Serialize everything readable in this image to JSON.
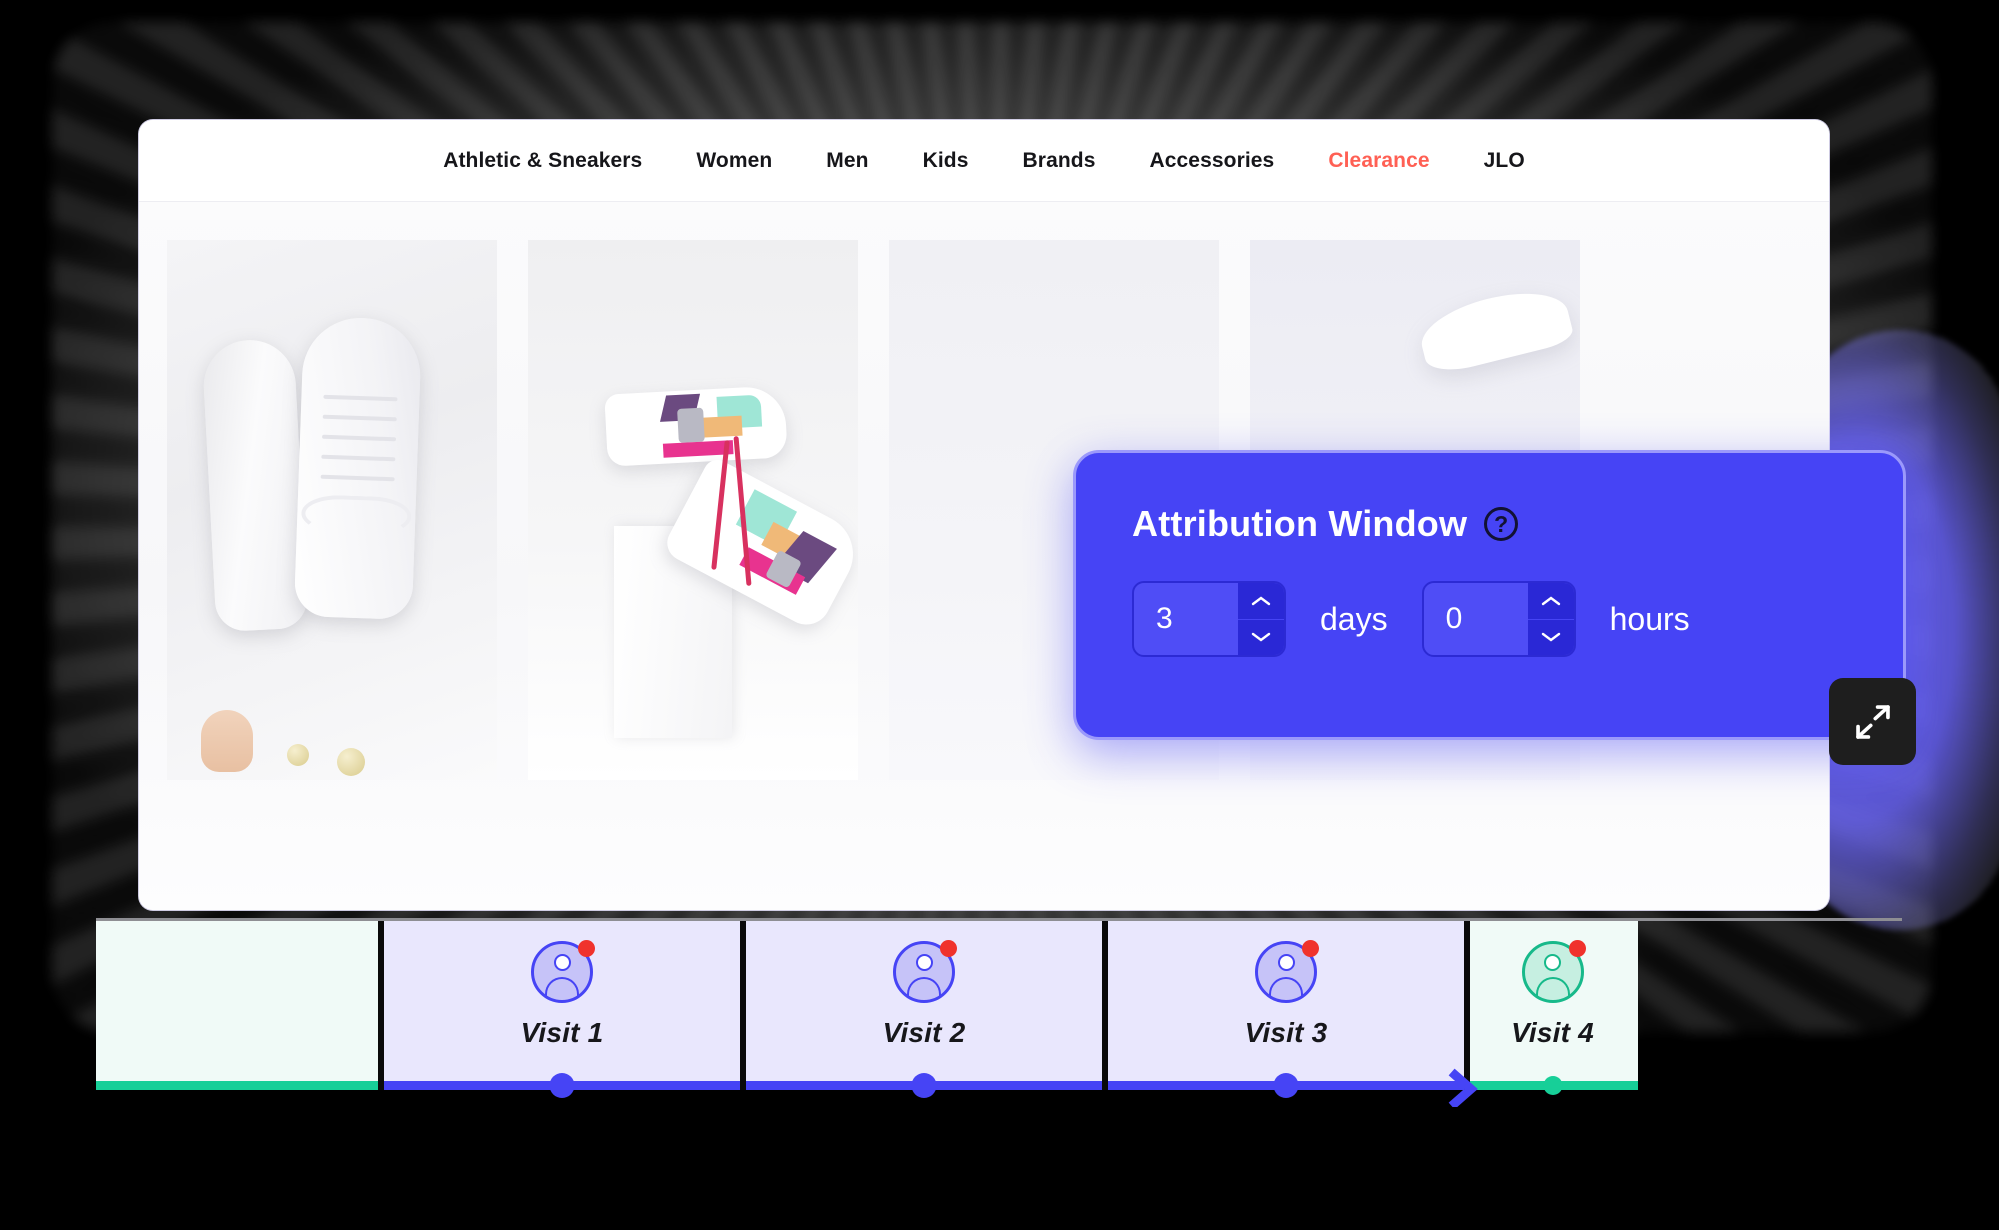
{
  "nav": {
    "items": [
      {
        "label": "Athletic & Sneakers",
        "accent": false
      },
      {
        "label": "Women",
        "accent": false
      },
      {
        "label": "Men",
        "accent": false
      },
      {
        "label": "Kids",
        "accent": false
      },
      {
        "label": "Brands",
        "accent": false
      },
      {
        "label": "Accessories",
        "accent": false
      },
      {
        "label": "Clearance",
        "accent": true
      },
      {
        "label": "JLO",
        "accent": false
      }
    ]
  },
  "panel": {
    "title": "Attribution Window",
    "help_icon": "question-mark-circle-icon",
    "help_glyph": "?",
    "days": {
      "value": "3",
      "unit_label": "days"
    },
    "hours": {
      "value": "0",
      "unit_label": "hours"
    },
    "background_color": "#4644F5",
    "border_color": "#9B99FB"
  },
  "expand_button": {
    "icon": "expand-diagonal-arrows-icon"
  },
  "timeline": {
    "segments": [
      {
        "type": "pre",
        "label": "",
        "accent": "green",
        "has_avatar": false,
        "has_dot": false
      },
      {
        "type": "visit",
        "label": "Visit 1",
        "accent": "blue",
        "has_avatar": true,
        "has_dot": true
      },
      {
        "type": "visit",
        "label": "Visit 2",
        "accent": "blue",
        "has_avatar": true,
        "has_dot": true
      },
      {
        "type": "visit",
        "label": "Visit 3",
        "accent": "blue",
        "has_avatar": true,
        "has_dot": true
      },
      {
        "type": "visit-last",
        "label": "Visit 4",
        "accent": "green",
        "has_avatar": true,
        "has_dot": true
      }
    ],
    "colors": {
      "blue": "#4644F5",
      "green": "#17CF98",
      "lavender_bg": "#E9E7FD",
      "mint_bg": "#F0FAF7",
      "badge": "#F0322C"
    }
  },
  "product_tiles": [
    {
      "name": "white-leather-sneakers"
    },
    {
      "name": "colorblock-sneakers-on-pedestal"
    },
    {
      "name": "empty-tile"
    },
    {
      "name": "white-sneaker-partial"
    }
  ]
}
